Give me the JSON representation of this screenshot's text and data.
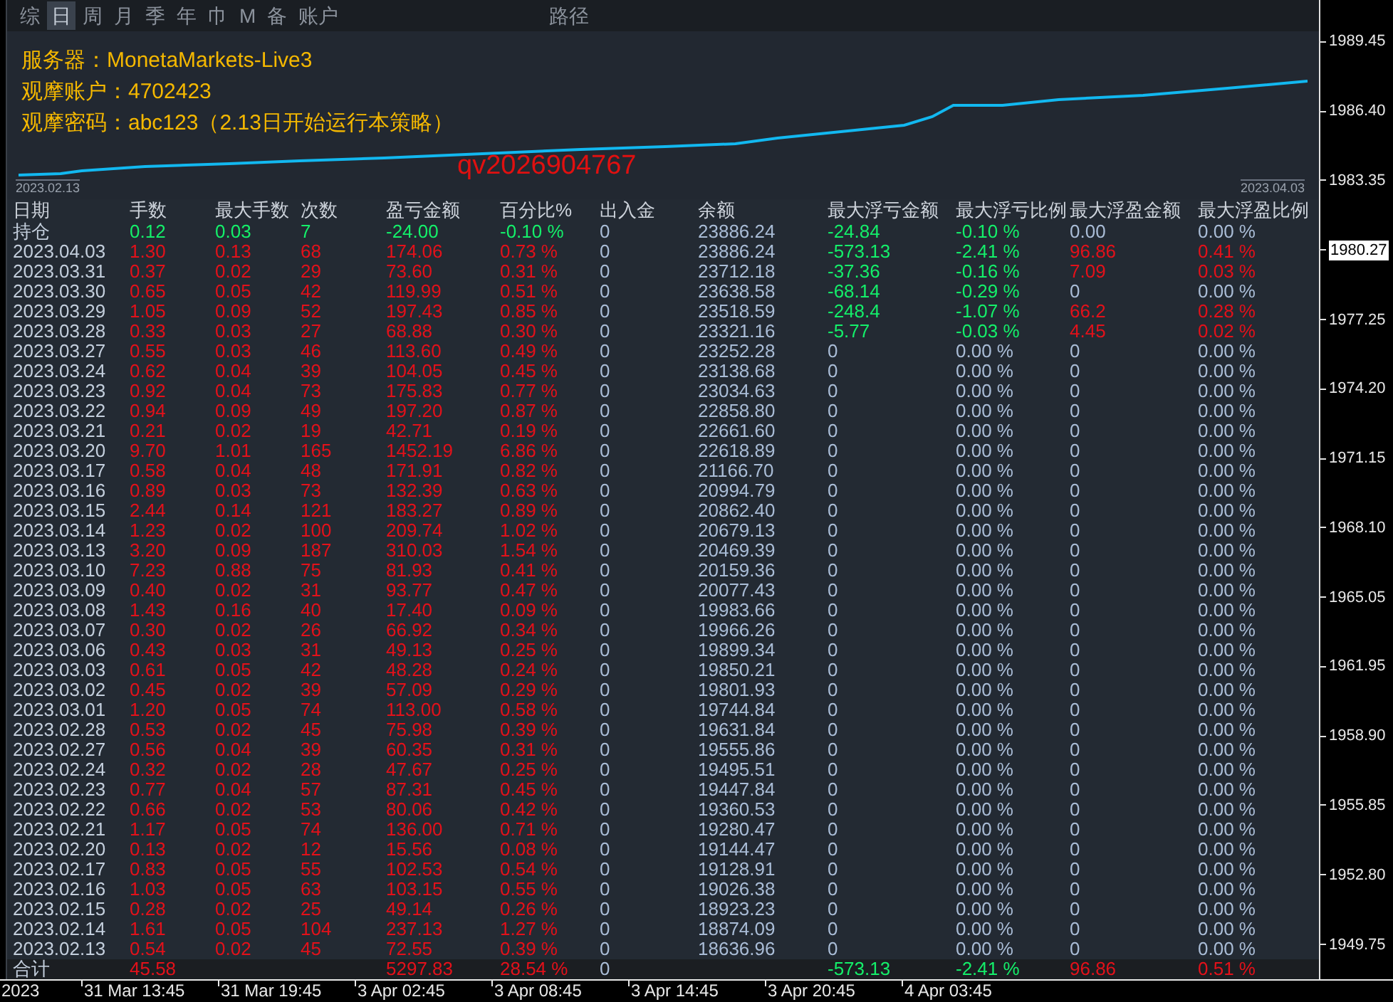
{
  "toolbar": {
    "items": [
      {
        "label": "综",
        "selected": false
      },
      {
        "label": "日",
        "selected": true
      },
      {
        "label": "周",
        "selected": false
      },
      {
        "label": "月",
        "selected": false
      },
      {
        "label": "季",
        "selected": false
      },
      {
        "label": "年",
        "selected": false
      },
      {
        "label": "巾",
        "selected": false
      },
      {
        "label": "M",
        "selected": false
      },
      {
        "label": "备",
        "selected": false
      },
      {
        "label": "账户",
        "selected": false
      }
    ],
    "path_label": "路径"
  },
  "chart": {
    "info_lines": [
      "服务器：MonetaMarkets-Live3",
      "观摩账户：4702423",
      "观摩密码：abc123（2.13日开始运行本策略）"
    ],
    "contact": "qv2026904767",
    "start_date": "2023.02.13",
    "end_date": "2023.04.03"
  },
  "table": {
    "columns": [
      "日期",
      "手数",
      "最大手数",
      "次数",
      "盈亏金额",
      "百分比%",
      "出入金",
      "余额",
      "最大浮亏金额",
      "最大浮亏比例",
      "最大浮盈金额",
      "最大浮盈比例"
    ],
    "rows": [
      {
        "kind": "holding",
        "cells": [
          "持仓",
          "0.12",
          "0.03",
          "7",
          "-24.00",
          "-0.10 %",
          "0",
          "23886.24",
          "-24.84",
          "-0.10 %",
          "0.00",
          "0.00 %"
        ],
        "loss_hit": true,
        "profit_hit": false
      },
      {
        "kind": "day",
        "cells": [
          "2023.04.03",
          "1.30",
          "0.13",
          "68",
          "174.06",
          "0.73 %",
          "0",
          "23886.24",
          "-573.13",
          "-2.41 %",
          "96.86",
          "0.41 %"
        ],
        "loss_hit": true,
        "profit_hit": true
      },
      {
        "kind": "day",
        "cells": [
          "2023.03.31",
          "0.37",
          "0.02",
          "29",
          "73.60",
          "0.31 %",
          "0",
          "23712.18",
          "-37.36",
          "-0.16 %",
          "7.09",
          "0.03 %"
        ],
        "loss_hit": true,
        "profit_hit": true
      },
      {
        "kind": "day",
        "cells": [
          "2023.03.30",
          "0.65",
          "0.05",
          "42",
          "119.99",
          "0.51 %",
          "0",
          "23638.58",
          "-68.14",
          "-0.29 %",
          "0",
          "0.00 %"
        ],
        "loss_hit": true,
        "profit_hit": false
      },
      {
        "kind": "day",
        "cells": [
          "2023.03.29",
          "1.05",
          "0.09",
          "52",
          "197.43",
          "0.85 %",
          "0",
          "23518.59",
          "-248.4",
          "-1.07 %",
          "66.2",
          "0.28 %"
        ],
        "loss_hit": true,
        "profit_hit": true
      },
      {
        "kind": "day",
        "cells": [
          "2023.03.28",
          "0.33",
          "0.03",
          "27",
          "68.88",
          "0.30 %",
          "0",
          "23321.16",
          "-5.77",
          "-0.03 %",
          "4.45",
          "0.02 %"
        ],
        "loss_hit": true,
        "profit_hit": true
      },
      {
        "kind": "day",
        "cells": [
          "2023.03.27",
          "0.55",
          "0.03",
          "46",
          "113.60",
          "0.49 %",
          "0",
          "23252.28",
          "0",
          "0.00 %",
          "0",
          "0.00 %"
        ],
        "loss_hit": false,
        "profit_hit": false
      },
      {
        "kind": "day",
        "cells": [
          "2023.03.24",
          "0.62",
          "0.04",
          "39",
          "104.05",
          "0.45 %",
          "0",
          "23138.68",
          "0",
          "0.00 %",
          "0",
          "0.00 %"
        ],
        "loss_hit": false,
        "profit_hit": false
      },
      {
        "kind": "day",
        "cells": [
          "2023.03.23",
          "0.92",
          "0.04",
          "73",
          "175.83",
          "0.77 %",
          "0",
          "23034.63",
          "0",
          "0.00 %",
          "0",
          "0.00 %"
        ],
        "loss_hit": false,
        "profit_hit": false
      },
      {
        "kind": "day",
        "cells": [
          "2023.03.22",
          "0.94",
          "0.09",
          "49",
          "197.20",
          "0.87 %",
          "0",
          "22858.80",
          "0",
          "0.00 %",
          "0",
          "0.00 %"
        ],
        "loss_hit": false,
        "profit_hit": false
      },
      {
        "kind": "day",
        "cells": [
          "2023.03.21",
          "0.21",
          "0.02",
          "19",
          "42.71",
          "0.19 %",
          "0",
          "22661.60",
          "0",
          "0.00 %",
          "0",
          "0.00 %"
        ],
        "loss_hit": false,
        "profit_hit": false
      },
      {
        "kind": "day",
        "cells": [
          "2023.03.20",
          "9.70",
          "1.01",
          "165",
          "1452.19",
          "6.86 %",
          "0",
          "22618.89",
          "0",
          "0.00 %",
          "0",
          "0.00 %"
        ],
        "loss_hit": false,
        "profit_hit": false
      },
      {
        "kind": "day",
        "cells": [
          "2023.03.17",
          "0.58",
          "0.04",
          "48",
          "171.91",
          "0.82 %",
          "0",
          "21166.70",
          "0",
          "0.00 %",
          "0",
          "0.00 %"
        ],
        "loss_hit": false,
        "profit_hit": false
      },
      {
        "kind": "day",
        "cells": [
          "2023.03.16",
          "0.89",
          "0.03",
          "73",
          "132.39",
          "0.63 %",
          "0",
          "20994.79",
          "0",
          "0.00 %",
          "0",
          "0.00 %"
        ],
        "loss_hit": false,
        "profit_hit": false
      },
      {
        "kind": "day",
        "cells": [
          "2023.03.15",
          "2.44",
          "0.14",
          "121",
          "183.27",
          "0.89 %",
          "0",
          "20862.40",
          "0",
          "0.00 %",
          "0",
          "0.00 %"
        ],
        "loss_hit": false,
        "profit_hit": false
      },
      {
        "kind": "day",
        "cells": [
          "2023.03.14",
          "1.23",
          "0.02",
          "100",
          "209.74",
          "1.02 %",
          "0",
          "20679.13",
          "0",
          "0.00 %",
          "0",
          "0.00 %"
        ],
        "loss_hit": false,
        "profit_hit": false
      },
      {
        "kind": "day",
        "cells": [
          "2023.03.13",
          "3.20",
          "0.09",
          "187",
          "310.03",
          "1.54 %",
          "0",
          "20469.39",
          "0",
          "0.00 %",
          "0",
          "0.00 %"
        ],
        "loss_hit": false,
        "profit_hit": false
      },
      {
        "kind": "day",
        "cells": [
          "2023.03.10",
          "7.23",
          "0.88",
          "75",
          "81.93",
          "0.41 %",
          "0",
          "20159.36",
          "0",
          "0.00 %",
          "0",
          "0.00 %"
        ],
        "loss_hit": false,
        "profit_hit": false
      },
      {
        "kind": "day",
        "cells": [
          "2023.03.09",
          "0.40",
          "0.02",
          "31",
          "93.77",
          "0.47 %",
          "0",
          "20077.43",
          "0",
          "0.00 %",
          "0",
          "0.00 %"
        ],
        "loss_hit": false,
        "profit_hit": false
      },
      {
        "kind": "day",
        "cells": [
          "2023.03.08",
          "1.43",
          "0.16",
          "40",
          "17.40",
          "0.09 %",
          "0",
          "19983.66",
          "0",
          "0.00 %",
          "0",
          "0.00 %"
        ],
        "loss_hit": false,
        "profit_hit": false
      },
      {
        "kind": "day",
        "cells": [
          "2023.03.07",
          "0.30",
          "0.02",
          "26",
          "66.92",
          "0.34 %",
          "0",
          "19966.26",
          "0",
          "0.00 %",
          "0",
          "0.00 %"
        ],
        "loss_hit": false,
        "profit_hit": false
      },
      {
        "kind": "day",
        "cells": [
          "2023.03.06",
          "0.43",
          "0.03",
          "31",
          "49.13",
          "0.25 %",
          "0",
          "19899.34",
          "0",
          "0.00 %",
          "0",
          "0.00 %"
        ],
        "loss_hit": false,
        "profit_hit": false
      },
      {
        "kind": "day",
        "cells": [
          "2023.03.03",
          "0.61",
          "0.05",
          "42",
          "48.28",
          "0.24 %",
          "0",
          "19850.21",
          "0",
          "0.00 %",
          "0",
          "0.00 %"
        ],
        "loss_hit": false,
        "profit_hit": false
      },
      {
        "kind": "day",
        "cells": [
          "2023.03.02",
          "0.45",
          "0.02",
          "39",
          "57.09",
          "0.29 %",
          "0",
          "19801.93",
          "0",
          "0.00 %",
          "0",
          "0.00 %"
        ],
        "loss_hit": false,
        "profit_hit": false
      },
      {
        "kind": "day",
        "cells": [
          "2023.03.01",
          "1.20",
          "0.05",
          "74",
          "113.00",
          "0.58 %",
          "0",
          "19744.84",
          "0",
          "0.00 %",
          "0",
          "0.00 %"
        ],
        "loss_hit": false,
        "profit_hit": false
      },
      {
        "kind": "day",
        "cells": [
          "2023.02.28",
          "0.53",
          "0.02",
          "45",
          "75.98",
          "0.39 %",
          "0",
          "19631.84",
          "0",
          "0.00 %",
          "0",
          "0.00 %"
        ],
        "loss_hit": false,
        "profit_hit": false
      },
      {
        "kind": "day",
        "cells": [
          "2023.02.27",
          "0.56",
          "0.04",
          "39",
          "60.35",
          "0.31 %",
          "0",
          "19555.86",
          "0",
          "0.00 %",
          "0",
          "0.00 %"
        ],
        "loss_hit": false,
        "profit_hit": false
      },
      {
        "kind": "day",
        "cells": [
          "2023.02.24",
          "0.32",
          "0.02",
          "28",
          "47.67",
          "0.25 %",
          "0",
          "19495.51",
          "0",
          "0.00 %",
          "0",
          "0.00 %"
        ],
        "loss_hit": false,
        "profit_hit": false
      },
      {
        "kind": "day",
        "cells": [
          "2023.02.23",
          "0.77",
          "0.04",
          "57",
          "87.31",
          "0.45 %",
          "0",
          "19447.84",
          "0",
          "0.00 %",
          "0",
          "0.00 %"
        ],
        "loss_hit": false,
        "profit_hit": false
      },
      {
        "kind": "day",
        "cells": [
          "2023.02.22",
          "0.66",
          "0.02",
          "53",
          "80.06",
          "0.42 %",
          "0",
          "19360.53",
          "0",
          "0.00 %",
          "0",
          "0.00 %"
        ],
        "loss_hit": false,
        "profit_hit": false
      },
      {
        "kind": "day",
        "cells": [
          "2023.02.21",
          "1.17",
          "0.05",
          "74",
          "136.00",
          "0.71 %",
          "0",
          "19280.47",
          "0",
          "0.00 %",
          "0",
          "0.00 %"
        ],
        "loss_hit": false,
        "profit_hit": false
      },
      {
        "kind": "day",
        "cells": [
          "2023.02.20",
          "0.13",
          "0.02",
          "12",
          "15.56",
          "0.08 %",
          "0",
          "19144.47",
          "0",
          "0.00 %",
          "0",
          "0.00 %"
        ],
        "loss_hit": false,
        "profit_hit": false
      },
      {
        "kind": "day",
        "cells": [
          "2023.02.17",
          "0.83",
          "0.05",
          "55",
          "102.53",
          "0.54 %",
          "0",
          "19128.91",
          "0",
          "0.00 %",
          "0",
          "0.00 %"
        ],
        "loss_hit": false,
        "profit_hit": false
      },
      {
        "kind": "day",
        "cells": [
          "2023.02.16",
          "1.03",
          "0.05",
          "63",
          "103.15",
          "0.55 %",
          "0",
          "19026.38",
          "0",
          "0.00 %",
          "0",
          "0.00 %"
        ],
        "loss_hit": false,
        "profit_hit": false
      },
      {
        "kind": "day",
        "cells": [
          "2023.02.15",
          "0.28",
          "0.02",
          "25",
          "49.14",
          "0.26 %",
          "0",
          "18923.23",
          "0",
          "0.00 %",
          "0",
          "0.00 %"
        ],
        "loss_hit": false,
        "profit_hit": false
      },
      {
        "kind": "day",
        "cells": [
          "2023.02.14",
          "1.61",
          "0.05",
          "104",
          "237.13",
          "1.27 %",
          "0",
          "18874.09",
          "0",
          "0.00 %",
          "0",
          "0.00 %"
        ],
        "loss_hit": false,
        "profit_hit": false
      },
      {
        "kind": "day",
        "cells": [
          "2023.02.13",
          "0.54",
          "0.02",
          "45",
          "72.55",
          "0.39 %",
          "0",
          "18636.96",
          "0",
          "0.00 %",
          "0",
          "0.00 %"
        ],
        "loss_hit": false,
        "profit_hit": false
      },
      {
        "kind": "total",
        "cells": [
          "合计",
          "45.58",
          null,
          null,
          "5297.83",
          "28.54 %",
          "0",
          null,
          "-573.13",
          "-2.41 %",
          "96.86",
          "0.51 %"
        ],
        "loss_hit": true,
        "profit_hit": true
      }
    ]
  },
  "price_axis": [
    {
      "label": "1989.45",
      "highlighted": false
    },
    {
      "label": "1986.40",
      "highlighted": false
    },
    {
      "label": "1983.35",
      "highlighted": false
    },
    {
      "label": "1980.27",
      "highlighted": true
    },
    {
      "label": "1977.25",
      "highlighted": false
    },
    {
      "label": "1974.20",
      "highlighted": false
    },
    {
      "label": "1971.15",
      "highlighted": false
    },
    {
      "label": "1968.10",
      "highlighted": false
    },
    {
      "label": "1965.05",
      "highlighted": false
    },
    {
      "label": "1961.95",
      "highlighted": false
    },
    {
      "label": "1958.90",
      "highlighted": false
    },
    {
      "label": "1955.85",
      "highlighted": false
    },
    {
      "label": "1952.80",
      "highlighted": false
    },
    {
      "label": "1949.75",
      "highlighted": false
    }
  ],
  "time_axis": [
    "2023",
    "31 Mar 13:45",
    "31 Mar 19:45",
    "3 Apr 02:45",
    "3 Apr 08:45",
    "3 Apr 14:45",
    "3 Apr 20:45",
    "4 Apr 03:45"
  ]
}
